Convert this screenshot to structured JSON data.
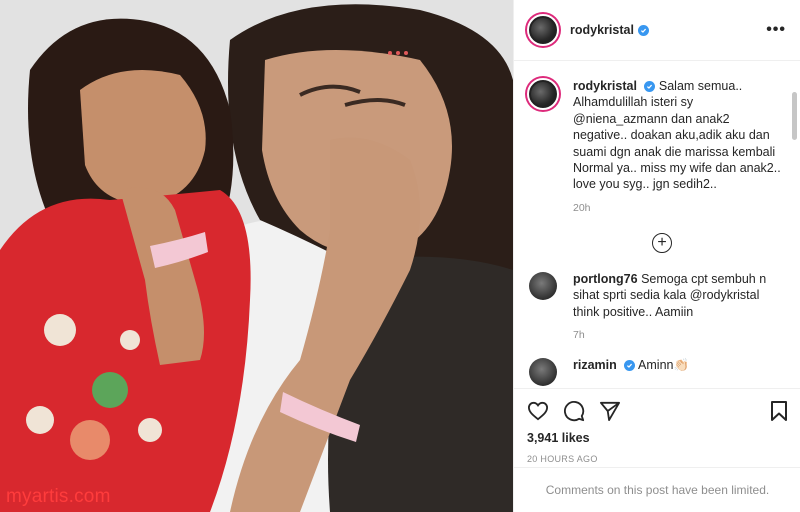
{
  "photo": {
    "watermark": "myartis.com"
  },
  "post": {
    "username": "rodykristal",
    "more_label": "•••",
    "caption": {
      "username": "rodykristal",
      "text": "Salam semua.. Alhamdulillah isteri sy @niena_azmann dan anak2 negative.. doakan aku,adik aku dan suami dgn anak die marissa kembali Normal ya.. miss my wife dan anak2.. love you syg.. jgn sedih2..",
      "time": "20h"
    },
    "load_more_label": "+",
    "comments": [
      {
        "username": "portlong76",
        "text": "Semoga cpt sembuh n sihat sprti sedia kala @rodykristal think positive.. Aamiin",
        "time": "7h"
      },
      {
        "username": "rizamin",
        "text": "Aminn👏🏻",
        "time": ""
      }
    ],
    "likes": "3,941 likes",
    "posted_ago": "20 HOURS AGO",
    "comments_limited": "Comments on this post have been limited."
  },
  "icons": {
    "like": "heart-icon",
    "comment": "comment-icon",
    "share": "paper-plane-icon",
    "save": "bookmark-icon",
    "verified": "verified-badge-icon",
    "more": "more-options-icon",
    "load_more": "plus-circle-icon"
  },
  "colors": {
    "verified": "#3897f0",
    "avatar_ring": "#dd2a7b",
    "watermark": "#ff3c3c",
    "muted_text": "#8e8e8e"
  }
}
